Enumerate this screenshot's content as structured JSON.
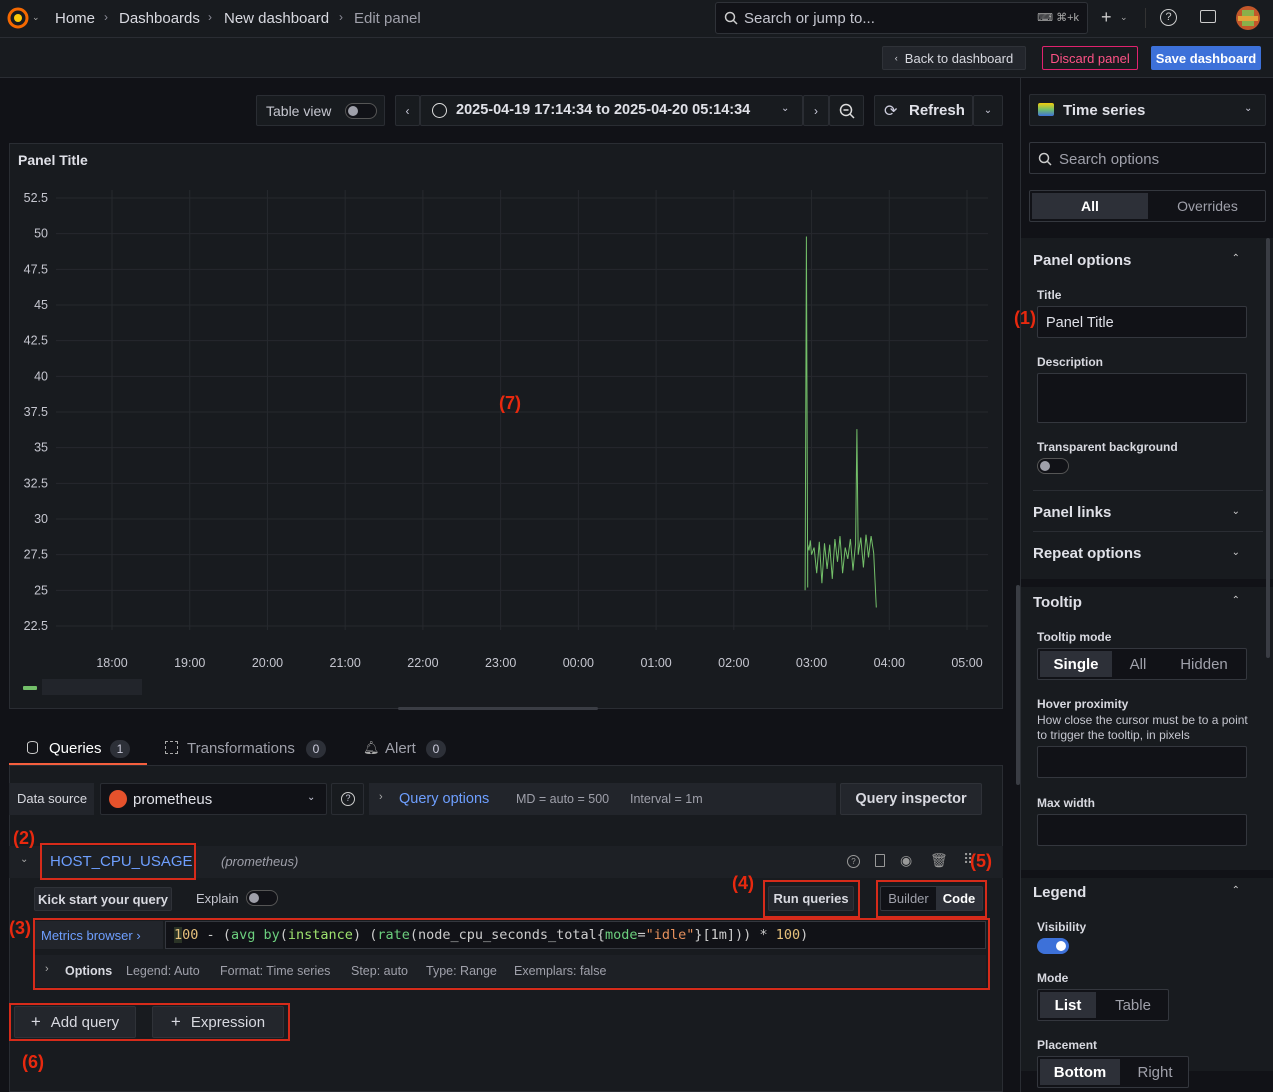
{
  "topbar": {
    "breadcrumbs": [
      "Home",
      "Dashboards",
      "New dashboard",
      "Edit panel"
    ],
    "search_placeholder": "Search or jump to...",
    "search_shortcut": "⌘+k",
    "plus_label": "+"
  },
  "actions": {
    "back": "Back to dashboard",
    "discard": "Discard panel",
    "save": "Save dashboard"
  },
  "toolbar": {
    "table_view": "Table view",
    "time_range": "2025-04-19 17:14:34 to 2025-04-20 05:14:34",
    "refresh": "Refresh"
  },
  "panel": {
    "title": "Panel Title"
  },
  "annotations": {
    "a1": "(1)",
    "a2": "(2)",
    "a3": "(3)",
    "a4": "(4)",
    "a5": "(5)",
    "a6": "(6)",
    "a7": "(7)"
  },
  "chart_data": {
    "type": "line",
    "title": "Panel Title",
    "y_ticks": [
      "52.5",
      "50",
      "47.5",
      "45",
      "42.5",
      "40",
      "37.5",
      "35",
      "32.5",
      "30",
      "27.5",
      "25",
      "22.5"
    ],
    "x_ticks": [
      "18:00",
      "19:00",
      "20:00",
      "21:00",
      "22:00",
      "23:00",
      "00:00",
      "01:00",
      "02:00",
      "03:00",
      "04:00",
      "05:00"
    ],
    "ylim": [
      22.5,
      52.5
    ],
    "series": [
      {
        "color": "#73bf69",
        "x": [
          "02:55",
          "02:56",
          "02:57",
          "02:57",
          "02:58",
          "02:59",
          "03:00",
          "03:02",
          "03:04",
          "03:06",
          "03:08",
          "03:10",
          "03:12",
          "03:14",
          "03:16",
          "03:18",
          "03:20",
          "03:22",
          "03:24",
          "03:26",
          "03:28",
          "03:30",
          "03:32",
          "03:34",
          "03:35",
          "03:36",
          "03:38",
          "03:40",
          "03:42",
          "03:44",
          "03:46",
          "03:48",
          "03:50"
        ],
        "y": [
          25.0,
          49.8,
          25.2,
          28.2,
          27.8,
          28.5,
          27.5,
          28.0,
          26.2,
          28.4,
          25.5,
          28.3,
          26.5,
          28.2,
          25.8,
          28.6,
          27.0,
          28.8,
          26.2,
          28.0,
          27.2,
          28.6,
          26.4,
          28.3,
          36.3,
          27.5,
          28.7,
          26.6,
          28.9,
          27.3,
          28.8,
          27.6,
          23.8
        ]
      }
    ],
    "grid": true,
    "legend": "bottom-left"
  },
  "query_tabs": [
    {
      "label": "Queries",
      "count": "1"
    },
    {
      "label": "Transformations",
      "count": "0"
    },
    {
      "label": "Alert",
      "count": "0"
    }
  ],
  "datasource": {
    "label": "Data source",
    "value": "prometheus",
    "query_options": "Query options",
    "md": "MD = auto = 500",
    "interval": "Interval = 1m",
    "inspector": "Query inspector"
  },
  "query": {
    "name": "HOST_CPU_USAGE",
    "source": "(prometheus)",
    "kickstart": "Kick start your query",
    "explain": "Explain",
    "run": "Run queries",
    "builder": "Builder",
    "code_mode": "Code",
    "metrics_browser": "Metrics browser ›",
    "options_label": "Options",
    "legend": "Legend: Auto",
    "format": "Format: Time series",
    "step": "Step: auto",
    "type": "Type: Range",
    "exemplars": "Exemplars: false",
    "add_query": "Add query",
    "expression": "Expression"
  },
  "sidebar": {
    "viz": "Time series",
    "search_placeholder": "Search options",
    "tab_all": "All",
    "tab_overrides": "Overrides",
    "panel_options": "Panel options",
    "title_label": "Title",
    "title_value": "Panel Title",
    "description_label": "Description",
    "transparent_label": "Transparent background",
    "panel_links": "Panel links",
    "repeat_options": "Repeat options",
    "tooltip": "Tooltip",
    "tooltip_mode": "Tooltip mode",
    "mode_single": "Single",
    "mode_all": "All",
    "mode_hidden": "Hidden",
    "hover_proximity": "Hover proximity",
    "hover_desc": "How close the cursor must be to a point to trigger the tooltip, in pixels",
    "max_width": "Max width",
    "legend": "Legend",
    "visibility": "Visibility",
    "mode": "Mode",
    "mode_list": "List",
    "mode_table": "Table",
    "placement": "Placement",
    "place_bottom": "Bottom",
    "place_right": "Right"
  },
  "colors": {
    "accent": "#3d71d9",
    "series": "#73bf69",
    "annotation": "#e8290f",
    "danger": "#e0226e"
  }
}
